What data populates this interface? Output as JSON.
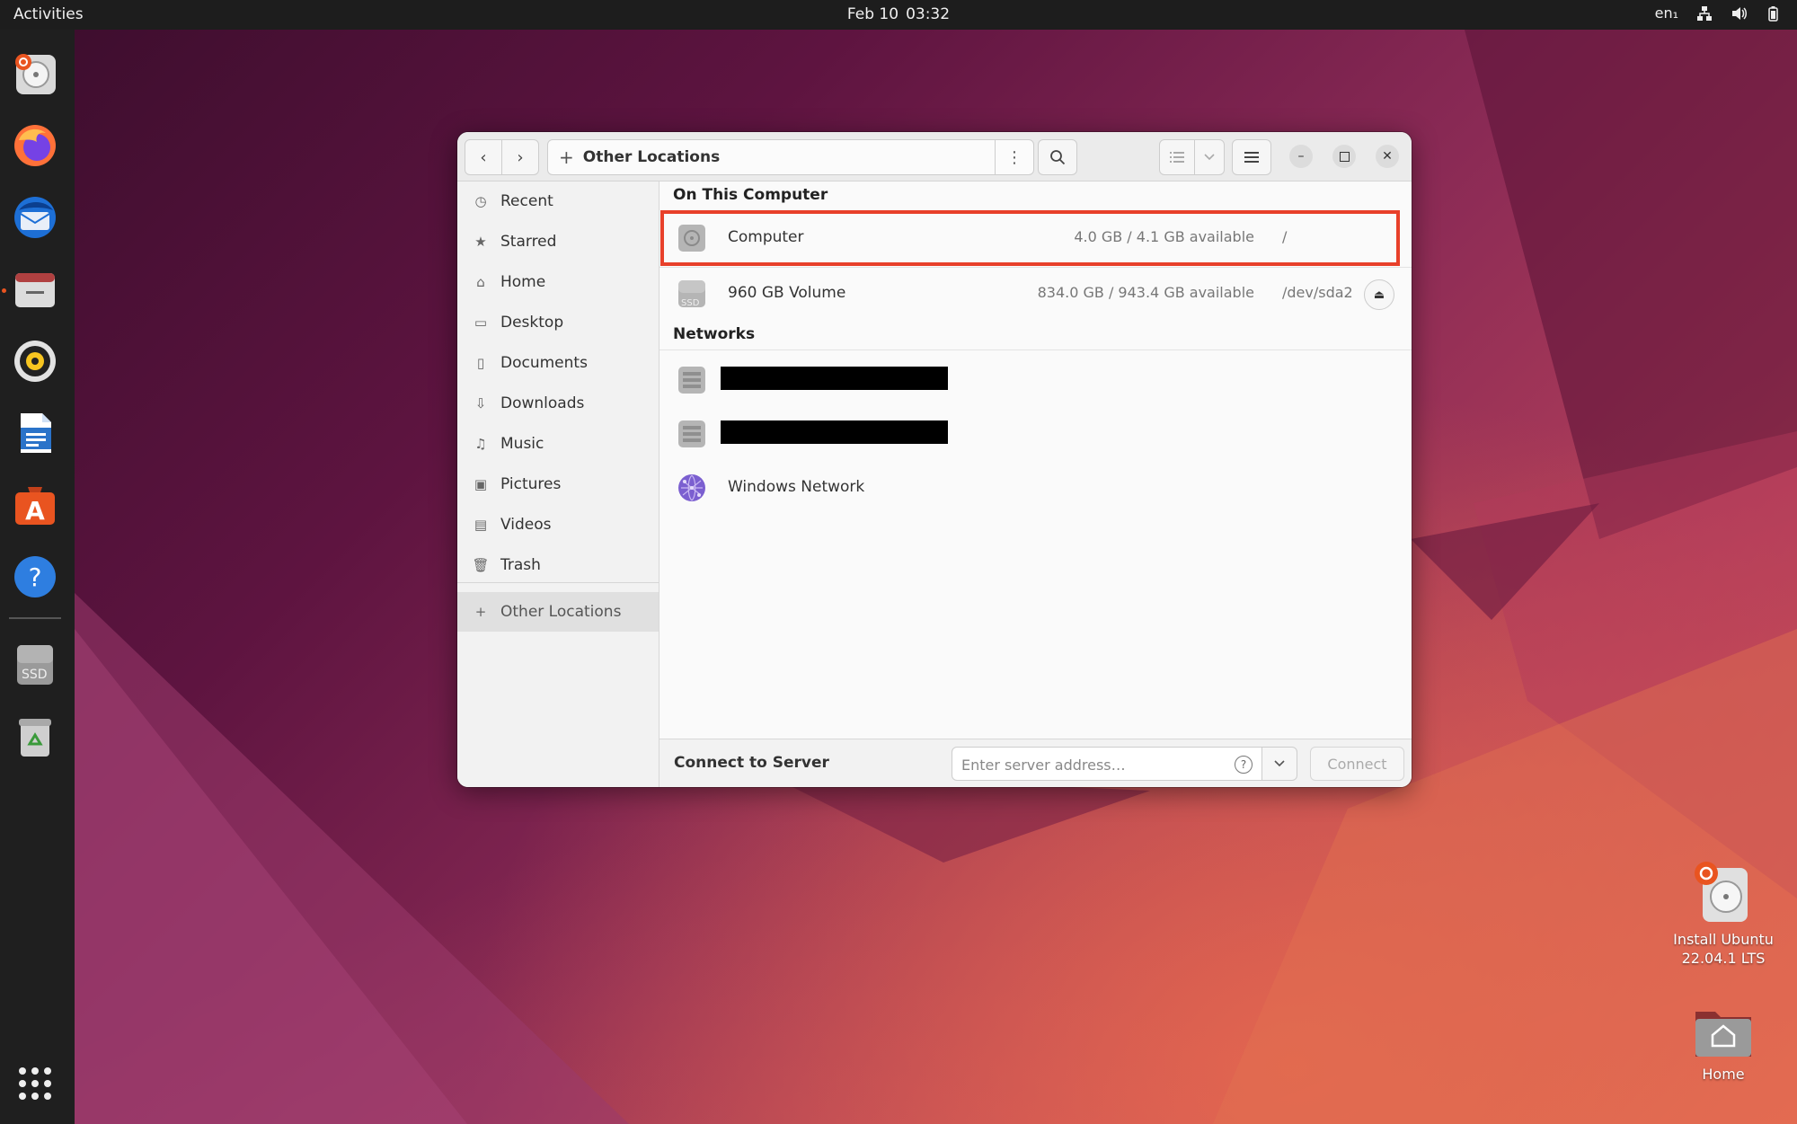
{
  "topbar": {
    "activities": "Activities",
    "date": "Feb 10",
    "time": "03:32",
    "lang": "en₁"
  },
  "dock": {
    "apps": [
      "ubuntu-installer-icon",
      "firefox-icon",
      "thunderbird-icon",
      "files-icon",
      "rhythmbox-icon",
      "writer-icon",
      "app-center-icon",
      "help-icon",
      "ssd-drive-icon",
      "trash-icon"
    ],
    "ssd_label": "SSD"
  },
  "window": {
    "location": "Other Locations",
    "sidebar": {
      "items": [
        {
          "label": "Recent",
          "icon": "clock-icon"
        },
        {
          "label": "Starred",
          "icon": "star-icon"
        },
        {
          "label": "Home",
          "icon": "home-icon"
        },
        {
          "label": "Desktop",
          "icon": "folder-icon"
        },
        {
          "label": "Documents",
          "icon": "document-icon"
        },
        {
          "label": "Downloads",
          "icon": "download-icon"
        },
        {
          "label": "Music",
          "icon": "music-icon"
        },
        {
          "label": "Pictures",
          "icon": "pictures-icon"
        },
        {
          "label": "Videos",
          "icon": "video-icon"
        },
        {
          "label": "Trash",
          "icon": "trash-icon"
        }
      ],
      "other_locations": "Other Locations"
    },
    "on_this_computer": "On This Computer",
    "drives": [
      {
        "name": "Computer",
        "size": "4.0 GB / 4.1 GB available",
        "path": "/"
      },
      {
        "name": "960 GB Volume",
        "size": "834.0 GB / 943.4 GB available",
        "path": "/dev/sda2",
        "icon_text": "SSD"
      }
    ],
    "networks_title": "Networks",
    "networks": [
      {
        "name": "Windows Network"
      }
    ],
    "footer": {
      "label": "Connect to Server",
      "placeholder": "Enter server address…",
      "connect": "Connect"
    }
  },
  "desktop": {
    "installer": "Install Ubuntu 22.04.1 LTS",
    "home": "Home"
  },
  "colors": {
    "accent": "#e95420",
    "highlight": "#e8402a"
  }
}
